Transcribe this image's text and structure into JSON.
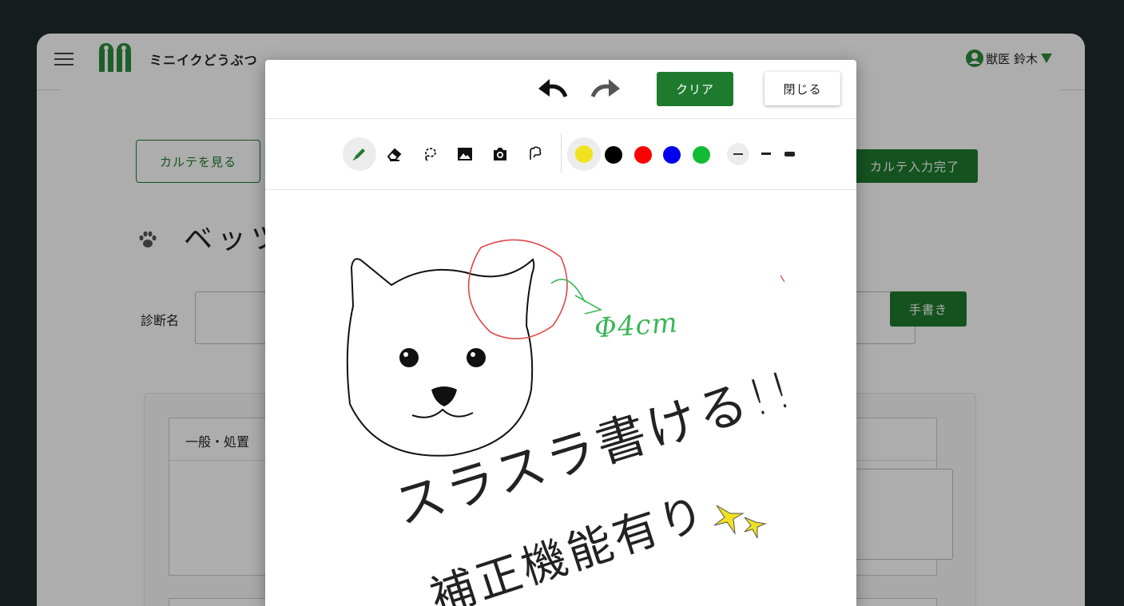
{
  "app": {
    "brand": "ミニイクどうぶつ",
    "user_name": "獣医 鈴木"
  },
  "page": {
    "view_chart_button": "カルテを見る",
    "complete_button": "カルテ入力完了",
    "pet_name": "ベッツ",
    "diagnosis_label": "診断名",
    "handwrite_button": "手書き",
    "section_tab": "一般・処置"
  },
  "modal": {
    "clear_button": "クリア",
    "close_button": "閉じる",
    "tools": [
      "pen",
      "eraser",
      "lasso",
      "image",
      "camera",
      "shape"
    ],
    "colors": [
      "#f1e21f",
      "#000000",
      "#ff0000",
      "#0000ee",
      "#11bb33"
    ],
    "selected_color": "#f1e21f",
    "stroke_widths": [
      "thin",
      "medium",
      "thick"
    ],
    "annotation_size": "Φ4cm",
    "handwriting_line1": "スラスラ書ける!!",
    "handwriting_line2": "補正機能有り"
  },
  "colors": {
    "primary": "#1e7b2e",
    "frame": "#1f2a2c"
  }
}
